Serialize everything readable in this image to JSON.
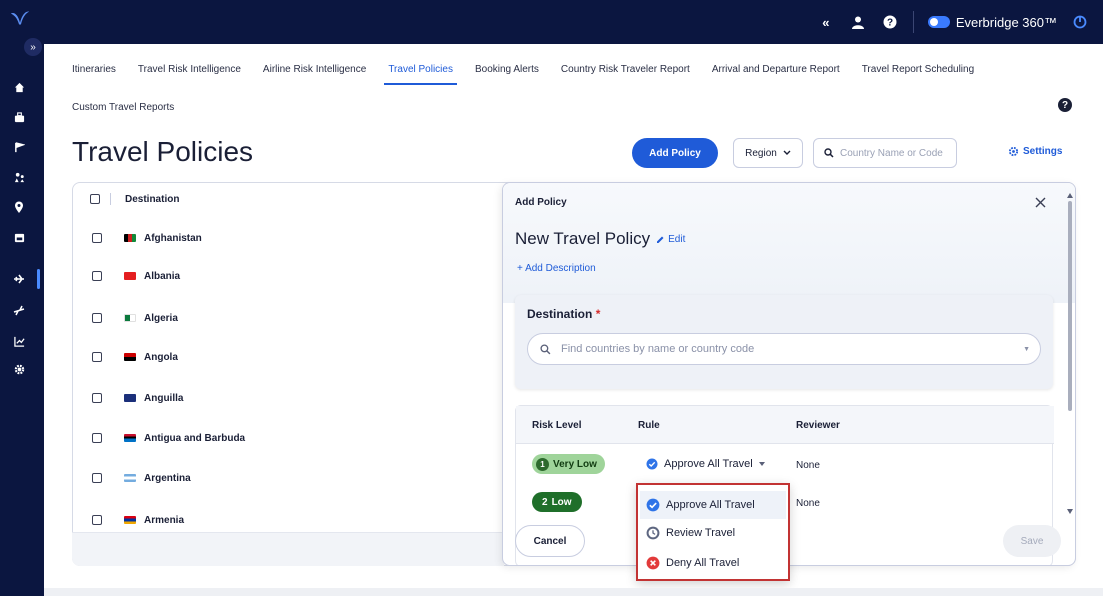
{
  "header": {
    "collapse_icon_text": "«",
    "product_name": "Everbridge 360™",
    "colors": {
      "bar": "#0b1640",
      "accent": "#1f5bd8"
    }
  },
  "tabs": [
    {
      "label": "Itineraries"
    },
    {
      "label": "Travel Risk Intelligence"
    },
    {
      "label": "Airline Risk Intelligence"
    },
    {
      "label": "Travel Policies",
      "active": true
    },
    {
      "label": "Booking Alerts"
    },
    {
      "label": "Country Risk Traveler Report"
    },
    {
      "label": "Arrival and Departure Report"
    },
    {
      "label": "Travel Report Scheduling"
    }
  ],
  "tab_row2": {
    "label": "Custom Travel Reports"
  },
  "page": {
    "title": "Travel Policies",
    "add_policy_label": "Add Policy",
    "region_label": "Region",
    "search_placeholder": "Country Name or Code",
    "settings_label": "Settings"
  },
  "table": {
    "header": "Destination",
    "rows": [
      {
        "name": "Afghanistan",
        "flag": [
          "#000000",
          "#cc1f1f",
          "#128a3a"
        ]
      },
      {
        "name": "Albania",
        "flag": [
          "#e41e20",
          "#e41e20",
          "#e41e20"
        ]
      },
      {
        "name": "Algeria",
        "flag": [
          "#0b7a3d",
          "#ffffff",
          "#ffffff"
        ]
      },
      {
        "name": "Angola",
        "flag": [
          "#cc0000",
          "#cc0000",
          "#000000"
        ]
      },
      {
        "name": "Anguilla",
        "flag": [
          "#1b2f7a",
          "#1b2f7a",
          "#ffffff"
        ]
      },
      {
        "name": "Antigua and Barbuda",
        "flag": [
          "#c8102e",
          "#0072c6",
          "#c8102e"
        ]
      },
      {
        "name": "Argentina",
        "flag": [
          "#74acdf",
          "#ffffff",
          "#74acdf"
        ]
      },
      {
        "name": "Armenia",
        "flag": [
          "#d90012",
          "#0033a0",
          "#f2a800"
        ]
      }
    ]
  },
  "drawer": {
    "label": "Add Policy",
    "policy_name": "New Travel Policy",
    "edit_label": "Edit",
    "add_description_label": "+ Add Description",
    "destination_label": "Destination",
    "required_mark": "*",
    "destination_placeholder": "Find countries by name or country code",
    "risk_columns": {
      "risk_level": "Risk Level",
      "rule": "Rule",
      "reviewer": "Reviewer"
    },
    "risk_rows": [
      {
        "num": "1",
        "level": "Very Low",
        "rule": "Approve All Travel",
        "reviewer": "None",
        "bg": "#9fd49a",
        "fg": "#123d12",
        "num_bg": "#2d6a2d",
        "num_fg": "#ffffff"
      },
      {
        "num": "2",
        "level": "Low",
        "rule": "",
        "reviewer": "None",
        "bg": "#1f6f2a",
        "fg": "#ffffff",
        "num_bg": "#1f6f2a",
        "num_fg": "#ffffff"
      }
    ],
    "cancel_label": "Cancel",
    "save_label": "Save"
  },
  "rule_menu": {
    "options": [
      {
        "label": "Approve All Travel",
        "icon": "check-circle-icon",
        "selected": true
      },
      {
        "label": "Review Travel",
        "icon": "clock-icon"
      },
      {
        "label": "Deny All Travel",
        "icon": "x-circle-icon"
      }
    ]
  }
}
